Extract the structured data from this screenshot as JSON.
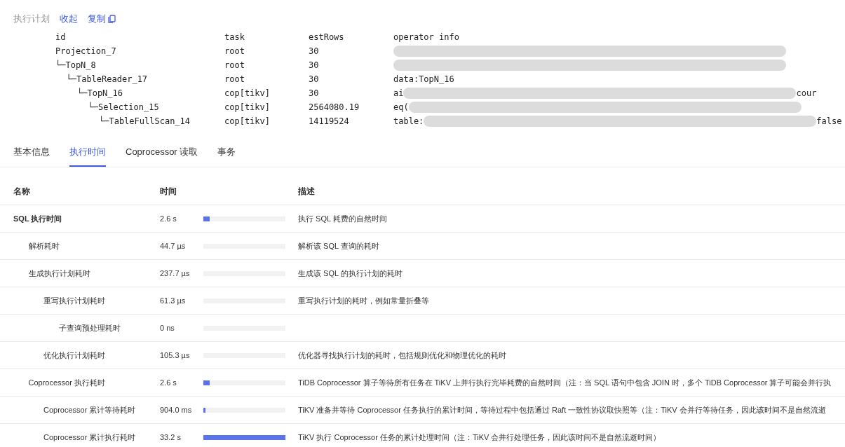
{
  "plan_header": {
    "title": "执行计划",
    "collapse_link": "收起",
    "copy_link": "复制"
  },
  "plan": {
    "columns": [
      "id",
      "task",
      "estRows",
      "operator info"
    ],
    "rows": [
      {
        "id": "Projection_7",
        "task": "root",
        "est_rows": "30",
        "info": [
          {
            "kind": "redaction"
          }
        ],
        "children": [
          {
            "id": "└─TopN_8",
            "task": "root",
            "est_rows": "30",
            "info": [
              {
                "kind": "redaction"
              }
            ],
            "children": [
              {
                "id": "└─TableReader_17",
                "task": "root",
                "est_rows": "30",
                "info": [
                  {
                    "kind": "text",
                    "text": "data:TopN_16"
                  }
                ],
                "children": [
                  {
                    "id": "└─TopN_16",
                    "task": "cop[tikv]",
                    "est_rows": "30",
                    "info": [
                      {
                        "kind": "text",
                        "text": "ai"
                      },
                      {
                        "kind": "redaction"
                      },
                      {
                        "kind": "text",
                        "text": "cour"
                      }
                    ],
                    "children": [
                      {
                        "id": "└─Selection_15",
                        "task": "cop[tikv]",
                        "est_rows": "2564080.19",
                        "info": [
                          {
                            "kind": "text",
                            "text": "eq("
                          },
                          {
                            "kind": "redaction"
                          }
                        ],
                        "children": [
                          {
                            "id": "└─TableFullScan_14",
                            "task": "cop[tikv]",
                            "est_rows": "14119524",
                            "info": [
                              {
                                "kind": "text",
                                "text": "table:"
                              },
                              {
                                "kind": "redaction"
                              },
                              {
                                "kind": "text",
                                "text": "false"
                              }
                            ]
                          }
                        ]
                      }
                    ]
                  }
                ]
              }
            ]
          }
        ]
      }
    ]
  },
  "tabs": [
    {
      "label": "基本信息",
      "selected": false
    },
    {
      "label": "执行时间",
      "selected": true
    },
    {
      "label": "Coprocessor 读取",
      "selected": false
    },
    {
      "label": "事务",
      "selected": false
    }
  ],
  "timing": {
    "columns": [
      "名称",
      "时间",
      "描述"
    ],
    "rows": [
      {
        "name": "SQL 执行时间",
        "time": "2.6 s",
        "level": 0.078,
        "desc": "执行 SQL 耗费的自然时间",
        "children": [
          {
            "name": "解析耗时",
            "time": "44.7 µs",
            "level": 0,
            "desc": "解析该 SQL 查询的耗时"
          },
          {
            "name": "生成执行计划耗时",
            "time": "237.7 µs",
            "level": 0,
            "desc": "生成该 SQL 的执行计划的耗时",
            "children": [
              {
                "name": "重写执行计划耗时",
                "time": "61.3 µs",
                "level": 0,
                "desc": "重写执行计划的耗时，例如常量折叠等",
                "children": [
                  {
                    "name": "子查询预处理耗时",
                    "time": "0 ns",
                    "level": 0
                  }
                ]
              },
              {
                "name": "优化执行计划耗时",
                "time": "105.3 µs",
                "level": 0,
                "desc": "优化器寻找执行计划的耗时，包括规则优化和物理优化的耗时"
              }
            ]
          },
          {
            "name": "Coprocessor 执行耗时",
            "time": "2.6 s",
            "level": 0.078,
            "desc": "TiDB Coprocessor 算子等待所有任务在 TiKV 上并行执行完毕耗费的自然时间（注：当 SQL 语句中包含 JOIN 时，多个 TiDB Coprocessor 算子可能会并行执",
            "children": [
              {
                "name": "Coprocessor 累计等待耗时",
                "time": "904.0 ms",
                "level": 0.027,
                "desc": "TiKV 准备并等待 Coprocessor 任务执行的累计时间，等待过程中包括通过 Raft 一致性协议取快照等（注：TiKV 会并行等待任务，因此该时间不是自然流逝"
              },
              {
                "name": "Coprocessor 累计执行耗时",
                "time": "33.2 s",
                "level": 1,
                "desc": "TiKV 执行 Coprocessor 任务的累计处理时间（注：TiKV 会并行处理任务，因此该时间不是自然流逝时间）"
              }
            ]
          }
        ]
      }
    ]
  }
}
